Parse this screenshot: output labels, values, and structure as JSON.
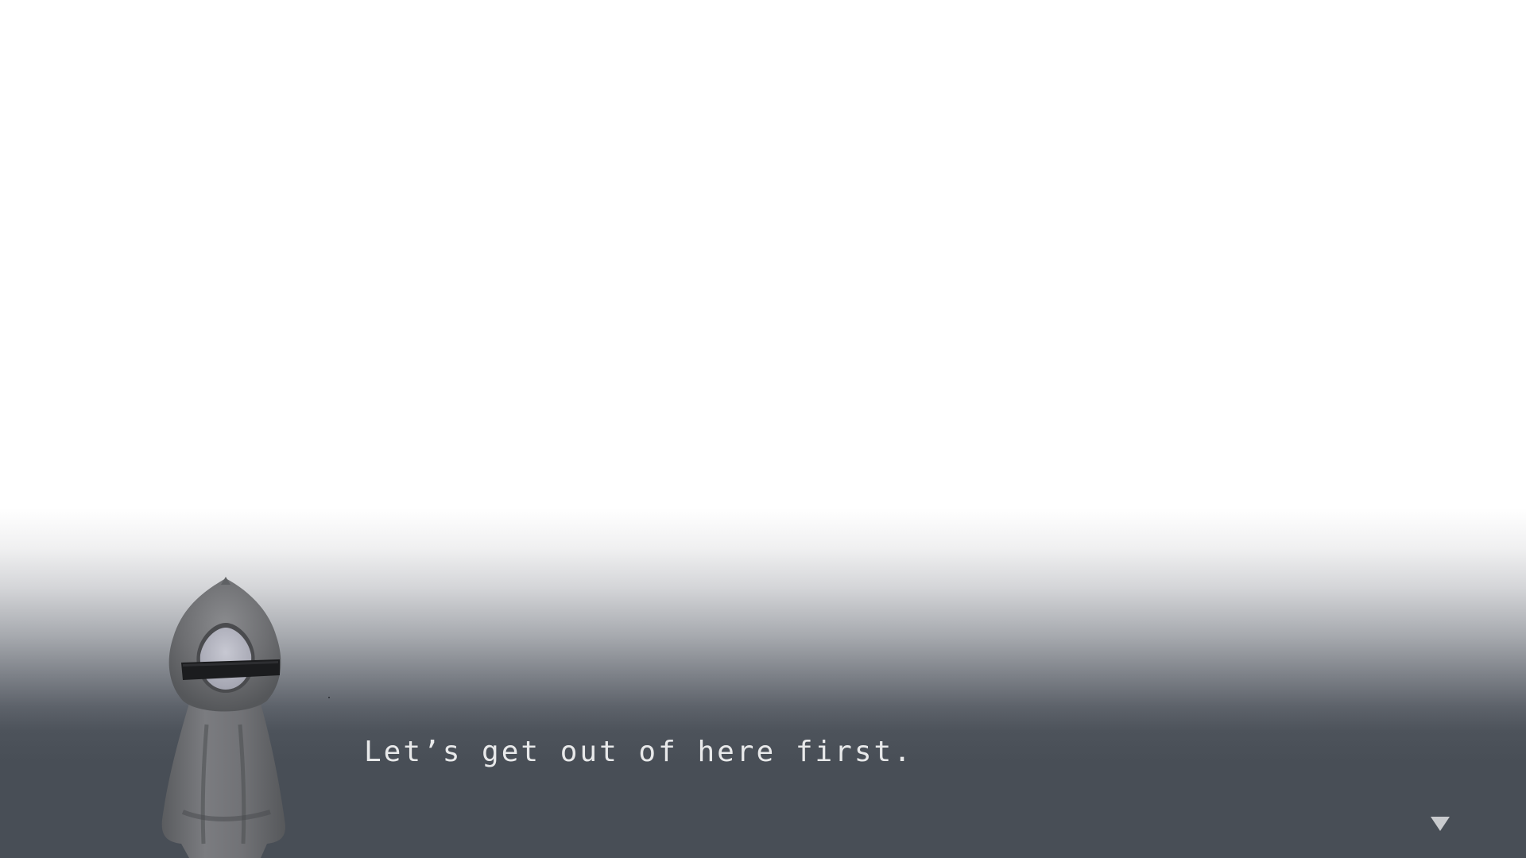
{
  "dialogue": {
    "text": "Let’s get out of here first."
  },
  "portrait": {
    "icon": "hooded-figure-portrait"
  },
  "advance_indicator": {
    "icon": "down-triangle-icon",
    "color": "#c9cbce"
  },
  "colors": {
    "sky": "#ffffff",
    "ground": "#484e56",
    "text": "#e8e9ea"
  }
}
